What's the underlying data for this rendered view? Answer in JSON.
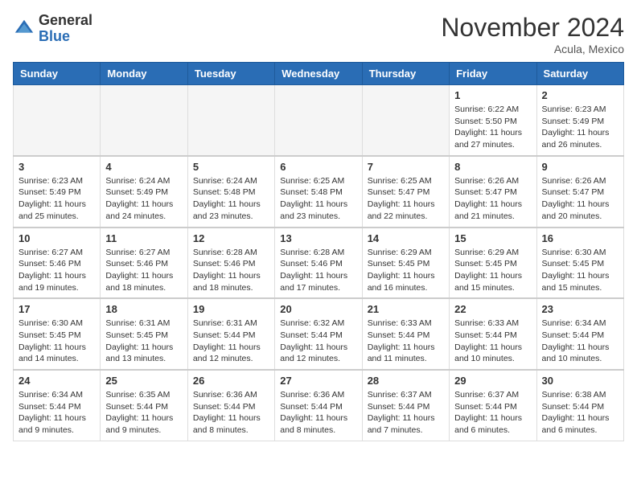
{
  "header": {
    "logo_line1": "General",
    "logo_line2": "Blue",
    "month": "November 2024",
    "location": "Acula, Mexico"
  },
  "weekdays": [
    "Sunday",
    "Monday",
    "Tuesday",
    "Wednesday",
    "Thursday",
    "Friday",
    "Saturday"
  ],
  "weeks": [
    [
      {
        "day": "",
        "info": ""
      },
      {
        "day": "",
        "info": ""
      },
      {
        "day": "",
        "info": ""
      },
      {
        "day": "",
        "info": ""
      },
      {
        "day": "",
        "info": ""
      },
      {
        "day": "1",
        "info": "Sunrise: 6:22 AM\nSunset: 5:50 PM\nDaylight: 11 hours and 27 minutes."
      },
      {
        "day": "2",
        "info": "Sunrise: 6:23 AM\nSunset: 5:49 PM\nDaylight: 11 hours and 26 minutes."
      }
    ],
    [
      {
        "day": "3",
        "info": "Sunrise: 6:23 AM\nSunset: 5:49 PM\nDaylight: 11 hours and 25 minutes."
      },
      {
        "day": "4",
        "info": "Sunrise: 6:24 AM\nSunset: 5:49 PM\nDaylight: 11 hours and 24 minutes."
      },
      {
        "day": "5",
        "info": "Sunrise: 6:24 AM\nSunset: 5:48 PM\nDaylight: 11 hours and 23 minutes."
      },
      {
        "day": "6",
        "info": "Sunrise: 6:25 AM\nSunset: 5:48 PM\nDaylight: 11 hours and 23 minutes."
      },
      {
        "day": "7",
        "info": "Sunrise: 6:25 AM\nSunset: 5:47 PM\nDaylight: 11 hours and 22 minutes."
      },
      {
        "day": "8",
        "info": "Sunrise: 6:26 AM\nSunset: 5:47 PM\nDaylight: 11 hours and 21 minutes."
      },
      {
        "day": "9",
        "info": "Sunrise: 6:26 AM\nSunset: 5:47 PM\nDaylight: 11 hours and 20 minutes."
      }
    ],
    [
      {
        "day": "10",
        "info": "Sunrise: 6:27 AM\nSunset: 5:46 PM\nDaylight: 11 hours and 19 minutes."
      },
      {
        "day": "11",
        "info": "Sunrise: 6:27 AM\nSunset: 5:46 PM\nDaylight: 11 hours and 18 minutes."
      },
      {
        "day": "12",
        "info": "Sunrise: 6:28 AM\nSunset: 5:46 PM\nDaylight: 11 hours and 18 minutes."
      },
      {
        "day": "13",
        "info": "Sunrise: 6:28 AM\nSunset: 5:46 PM\nDaylight: 11 hours and 17 minutes."
      },
      {
        "day": "14",
        "info": "Sunrise: 6:29 AM\nSunset: 5:45 PM\nDaylight: 11 hours and 16 minutes."
      },
      {
        "day": "15",
        "info": "Sunrise: 6:29 AM\nSunset: 5:45 PM\nDaylight: 11 hours and 15 minutes."
      },
      {
        "day": "16",
        "info": "Sunrise: 6:30 AM\nSunset: 5:45 PM\nDaylight: 11 hours and 15 minutes."
      }
    ],
    [
      {
        "day": "17",
        "info": "Sunrise: 6:30 AM\nSunset: 5:45 PM\nDaylight: 11 hours and 14 minutes."
      },
      {
        "day": "18",
        "info": "Sunrise: 6:31 AM\nSunset: 5:45 PM\nDaylight: 11 hours and 13 minutes."
      },
      {
        "day": "19",
        "info": "Sunrise: 6:31 AM\nSunset: 5:44 PM\nDaylight: 11 hours and 12 minutes."
      },
      {
        "day": "20",
        "info": "Sunrise: 6:32 AM\nSunset: 5:44 PM\nDaylight: 11 hours and 12 minutes."
      },
      {
        "day": "21",
        "info": "Sunrise: 6:33 AM\nSunset: 5:44 PM\nDaylight: 11 hours and 11 minutes."
      },
      {
        "day": "22",
        "info": "Sunrise: 6:33 AM\nSunset: 5:44 PM\nDaylight: 11 hours and 10 minutes."
      },
      {
        "day": "23",
        "info": "Sunrise: 6:34 AM\nSunset: 5:44 PM\nDaylight: 11 hours and 10 minutes."
      }
    ],
    [
      {
        "day": "24",
        "info": "Sunrise: 6:34 AM\nSunset: 5:44 PM\nDaylight: 11 hours and 9 minutes."
      },
      {
        "day": "25",
        "info": "Sunrise: 6:35 AM\nSunset: 5:44 PM\nDaylight: 11 hours and 9 minutes."
      },
      {
        "day": "26",
        "info": "Sunrise: 6:36 AM\nSunset: 5:44 PM\nDaylight: 11 hours and 8 minutes."
      },
      {
        "day": "27",
        "info": "Sunrise: 6:36 AM\nSunset: 5:44 PM\nDaylight: 11 hours and 8 minutes."
      },
      {
        "day": "28",
        "info": "Sunrise: 6:37 AM\nSunset: 5:44 PM\nDaylight: 11 hours and 7 minutes."
      },
      {
        "day": "29",
        "info": "Sunrise: 6:37 AM\nSunset: 5:44 PM\nDaylight: 11 hours and 6 minutes."
      },
      {
        "day": "30",
        "info": "Sunrise: 6:38 AM\nSunset: 5:44 PM\nDaylight: 11 hours and 6 minutes."
      }
    ]
  ]
}
